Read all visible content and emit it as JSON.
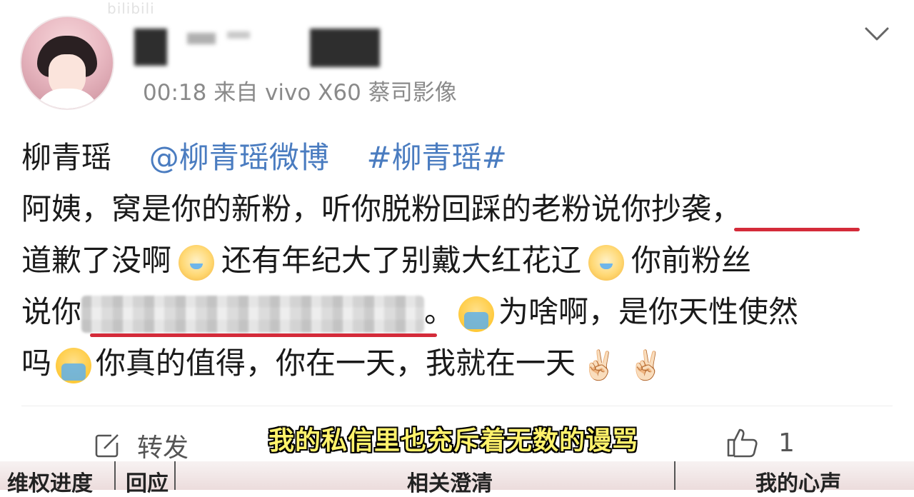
{
  "watermark": "bilibili",
  "post": {
    "meta": "00:18  来自 vivo X60 蔡司影像",
    "line1": {
      "name": "柳青瑶",
      "mention": "@柳青瑶微博",
      "hashtag": "#柳青瑶#"
    },
    "line2": {
      "text": "阿姨，窝是你的新粉，听你脱粉回踩的老粉说你抄袭，"
    },
    "line3": {
      "part1": "道歉了没啊",
      "part2": "还有年纪大了别戴大红花辽",
      "part3": "你前粉丝"
    },
    "line4": {
      "part1": "说你",
      "part2": "。",
      "part3": "为啥啊，是你天性使然"
    },
    "line5": {
      "part1": "吗",
      "part2": "你真的值得，你在一天，我就在一天",
      "hand1": "✌🏻",
      "hand2": "✌🏻"
    }
  },
  "actions": {
    "repost_label": "转发",
    "like_count": "1"
  },
  "subtitle": "我的私信里也充斥着无数的谩骂",
  "tabs": [
    "维权进度",
    "回应",
    "相关澄清",
    "我的心声"
  ],
  "icons": [
    "avatar",
    "chevron-down-icon",
    "repost-icon",
    "like-icon",
    "dog-tears-emoji",
    "crying-face-emoji",
    "victory-hand-emoji"
  ],
  "colors": {
    "link": "#4a7cc0",
    "underline": "#d42b3a",
    "subtitle": "#fff26b"
  }
}
